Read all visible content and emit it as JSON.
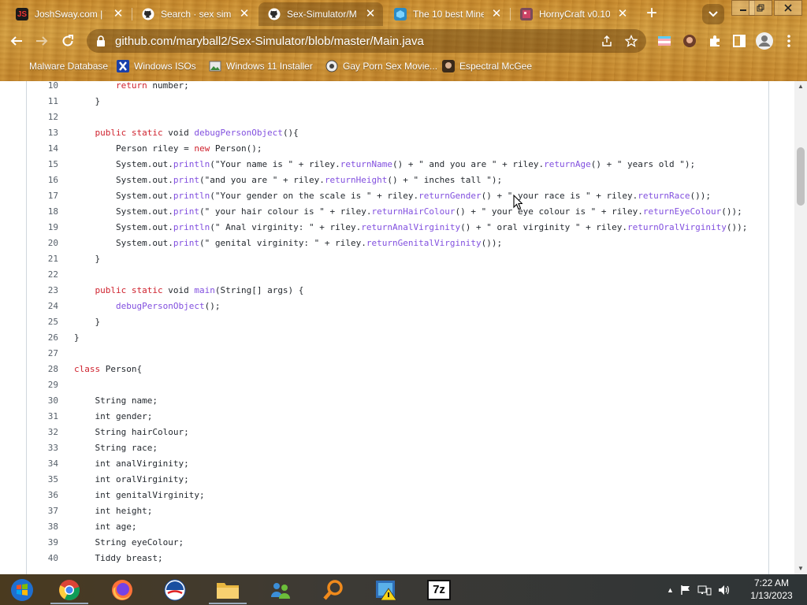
{
  "tabs": [
    {
      "title": "JoshSway.com | Y",
      "favicon": "joshsway-icon",
      "active": false
    },
    {
      "title": "Search · sex simul",
      "favicon": "github-icon",
      "active": false
    },
    {
      "title": "Sex-Simulator/M",
      "favicon": "github-icon",
      "active": true
    },
    {
      "title": "The 10 best Mine",
      "favicon": "planet-minecraft-icon",
      "active": false
    },
    {
      "title": "HornyCraft v0.10",
      "favicon": "game-icon",
      "active": false
    }
  ],
  "new_tab_label": "+",
  "address_bar": {
    "url": "github.com/maryball2/Sex-Simulator/blob/master/Main.java"
  },
  "bookmarks": [
    {
      "label": "Malware Database",
      "icon": "folder-icon"
    },
    {
      "label": "Windows ISOs",
      "icon": "x-icon"
    },
    {
      "label": "Windows 11 Installer",
      "icon": "image-icon"
    },
    {
      "label": "Gay Porn Sex Movie...",
      "icon": "site-icon"
    },
    {
      "label": "Espectral McGee",
      "icon": "avatar-icon"
    }
  ],
  "code": {
    "lines": [
      {
        "n": "10",
        "indent": 2,
        "parts": [
          {
            "t": "return",
            "c": "kw"
          },
          {
            "t": " number;",
            "c": ""
          }
        ]
      },
      {
        "n": "11",
        "indent": 1,
        "parts": [
          {
            "t": "}",
            "c": ""
          }
        ]
      },
      {
        "n": "12",
        "indent": 0,
        "parts": []
      },
      {
        "n": "13",
        "indent": 1,
        "parts": [
          {
            "t": "public static",
            "c": "kw"
          },
          {
            "t": " void ",
            "c": ""
          },
          {
            "t": "debugPersonObject",
            "c": "fn"
          },
          {
            "t": "(){",
            "c": ""
          }
        ]
      },
      {
        "n": "14",
        "indent": 2,
        "parts": [
          {
            "t": "Person riley = ",
            "c": ""
          },
          {
            "t": "new",
            "c": "kw"
          },
          {
            "t": " Person();",
            "c": ""
          }
        ]
      },
      {
        "n": "15",
        "indent": 2,
        "parts": [
          {
            "t": "System.out.",
            "c": ""
          },
          {
            "t": "println",
            "c": "fn"
          },
          {
            "t": "(\"Your name is \" + riley.",
            "c": ""
          },
          {
            "t": "returnName",
            "c": "fn"
          },
          {
            "t": "() + \" and you are \" + riley.",
            "c": ""
          },
          {
            "t": "returnAge",
            "c": "fn"
          },
          {
            "t": "() + \" years old \");",
            "c": ""
          }
        ]
      },
      {
        "n": "16",
        "indent": 2,
        "parts": [
          {
            "t": "System.out.",
            "c": ""
          },
          {
            "t": "print",
            "c": "fn"
          },
          {
            "t": "(\"and you are \" + riley.",
            "c": ""
          },
          {
            "t": "returnHeight",
            "c": "fn"
          },
          {
            "t": "() + \" inches tall \");",
            "c": ""
          }
        ]
      },
      {
        "n": "17",
        "indent": 2,
        "parts": [
          {
            "t": "System.out.",
            "c": ""
          },
          {
            "t": "println",
            "c": "fn"
          },
          {
            "t": "(\"Your gender on the scale is \" + riley.",
            "c": ""
          },
          {
            "t": "returnGender",
            "c": "fn"
          },
          {
            "t": "() + \" your race is \" + riley.",
            "c": ""
          },
          {
            "t": "returnRace",
            "c": "fn"
          },
          {
            "t": "());",
            "c": ""
          }
        ]
      },
      {
        "n": "18",
        "indent": 2,
        "parts": [
          {
            "t": "System.out.",
            "c": ""
          },
          {
            "t": "print",
            "c": "fn"
          },
          {
            "t": "(\" your hair colour is \" + riley.",
            "c": ""
          },
          {
            "t": "returnHairColour",
            "c": "fn"
          },
          {
            "t": "() + \" your eye colour is \" + riley.",
            "c": ""
          },
          {
            "t": "returnEyeColour",
            "c": "fn"
          },
          {
            "t": "());",
            "c": ""
          }
        ]
      },
      {
        "n": "19",
        "indent": 2,
        "parts": [
          {
            "t": "System.out.",
            "c": ""
          },
          {
            "t": "println",
            "c": "fn"
          },
          {
            "t": "(\" Anal virginity: \" + riley.",
            "c": ""
          },
          {
            "t": "returnAnalVirginity",
            "c": "fn"
          },
          {
            "t": "() + \" oral virginity \" + riley.",
            "c": ""
          },
          {
            "t": "returnOralVirginity",
            "c": "fn"
          },
          {
            "t": "());",
            "c": ""
          }
        ]
      },
      {
        "n": "20",
        "indent": 2,
        "parts": [
          {
            "t": "System.out.",
            "c": ""
          },
          {
            "t": "print",
            "c": "fn"
          },
          {
            "t": "(\" genital virginity: \" + riley.",
            "c": ""
          },
          {
            "t": "returnGenitalVirginity",
            "c": "fn"
          },
          {
            "t": "());",
            "c": ""
          }
        ]
      },
      {
        "n": "21",
        "indent": 1,
        "parts": [
          {
            "t": "}",
            "c": ""
          }
        ]
      },
      {
        "n": "22",
        "indent": 0,
        "parts": []
      },
      {
        "n": "23",
        "indent": 1,
        "parts": [
          {
            "t": "public static",
            "c": "kw"
          },
          {
            "t": " void ",
            "c": ""
          },
          {
            "t": "main",
            "c": "fn"
          },
          {
            "t": "(String[] args) {",
            "c": ""
          }
        ]
      },
      {
        "n": "24",
        "indent": 2,
        "parts": [
          {
            "t": "debugPersonObject",
            "c": "fn"
          },
          {
            "t": "();",
            "c": ""
          }
        ]
      },
      {
        "n": "25",
        "indent": 1,
        "parts": [
          {
            "t": "}",
            "c": ""
          }
        ]
      },
      {
        "n": "26",
        "indent": 0,
        "parts": [
          {
            "t": "}",
            "c": ""
          }
        ]
      },
      {
        "n": "27",
        "indent": 0,
        "parts": []
      },
      {
        "n": "28",
        "indent": 0,
        "parts": [
          {
            "t": "class",
            "c": "kw"
          },
          {
            "t": " Person{",
            "c": ""
          }
        ]
      },
      {
        "n": "29",
        "indent": 0,
        "parts": []
      },
      {
        "n": "30",
        "indent": 1,
        "parts": [
          {
            "t": "String name;",
            "c": ""
          }
        ]
      },
      {
        "n": "31",
        "indent": 1,
        "parts": [
          {
            "t": "int gender;",
            "c": ""
          }
        ]
      },
      {
        "n": "32",
        "indent": 1,
        "parts": [
          {
            "t": "String hairColour;",
            "c": ""
          }
        ]
      },
      {
        "n": "33",
        "indent": 1,
        "parts": [
          {
            "t": "String race;",
            "c": ""
          }
        ]
      },
      {
        "n": "34",
        "indent": 1,
        "parts": [
          {
            "t": "int analVirginity;",
            "c": ""
          }
        ]
      },
      {
        "n": "35",
        "indent": 1,
        "parts": [
          {
            "t": "int oralVirginity;",
            "c": ""
          }
        ]
      },
      {
        "n": "36",
        "indent": 1,
        "parts": [
          {
            "t": "int genitalVirginity;",
            "c": ""
          }
        ]
      },
      {
        "n": "37",
        "indent": 1,
        "parts": [
          {
            "t": "int height;",
            "c": ""
          }
        ]
      },
      {
        "n": "38",
        "indent": 1,
        "parts": [
          {
            "t": "int age;",
            "c": ""
          }
        ]
      },
      {
        "n": "39",
        "indent": 1,
        "parts": [
          {
            "t": "String eyeColour;",
            "c": ""
          }
        ]
      },
      {
        "n": "40",
        "indent": 1,
        "parts": [
          {
            "t": "Tiddy breast;",
            "c": ""
          }
        ]
      }
    ]
  },
  "taskbar": {
    "apps": [
      {
        "name": "start-button",
        "icon": "windows-logo-icon"
      },
      {
        "name": "taskbar-chrome",
        "icon": "chrome-icon"
      },
      {
        "name": "taskbar-firefox",
        "icon": "firefox-icon"
      },
      {
        "name": "taskbar-obama",
        "icon": "obama-logo-icon"
      },
      {
        "name": "taskbar-file-explorer",
        "icon": "folder-icon"
      },
      {
        "name": "taskbar-network",
        "icon": "network-people-icon"
      },
      {
        "name": "taskbar-search",
        "icon": "magnifier-icon"
      },
      {
        "name": "taskbar-defender",
        "icon": "warning-shield-icon"
      },
      {
        "name": "taskbar-7zip",
        "icon": "7zip-icon",
        "label": "7z"
      }
    ],
    "clock_time": "7:22 AM",
    "clock_date": "1/13/2023"
  },
  "colors": {
    "keyword": "#cf222e",
    "function": "#8250df",
    "text": "#24292f",
    "line_number": "#57606a"
  }
}
